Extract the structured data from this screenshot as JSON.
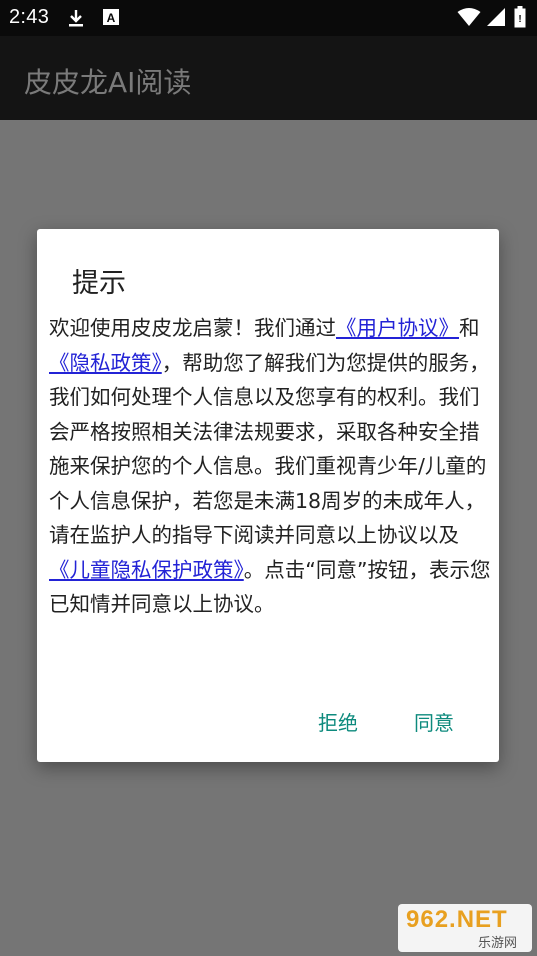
{
  "status_bar": {
    "time": "2:43",
    "left_icons": [
      "download-icon",
      "a-box-icon"
    ],
    "right_icons": [
      "wifi-icon",
      "signal-icon",
      "battery-icon"
    ]
  },
  "app_bar": {
    "title": "皮皮龙AI阅读"
  },
  "dialog": {
    "title": "提示",
    "message_parts": {
      "p1": "欢迎使用皮皮龙启蒙！我们通过",
      "link_user_agreement": "《用户协议》",
      "p2": "和",
      "link_privacy_policy": "《隐私政策》",
      "p3": "，帮助您了解我们为您提供的服务，我们如何处理个人信息以及您享有的权利。我们会严格按照相关法律法规要求，采取各种安全措施来保护您的个人信息。我们重视青少年/儿童的个人信息保护，若您是未满18周岁的未成年人，请在监护人的指导下阅读并同意以上协议以及",
      "link_child_privacy": "《儿童隐私保护政策》",
      "p4": "。点击“同意”按钮，表示您已知情并同意以上协议。"
    },
    "buttons": {
      "reject": "拒绝",
      "agree": "同意"
    }
  },
  "watermark": {
    "top": "962.NET",
    "bottom": "乐游网"
  },
  "colors": {
    "overlay": "#757575",
    "link": "#2323d6",
    "button_text": "#0d8a7d"
  }
}
